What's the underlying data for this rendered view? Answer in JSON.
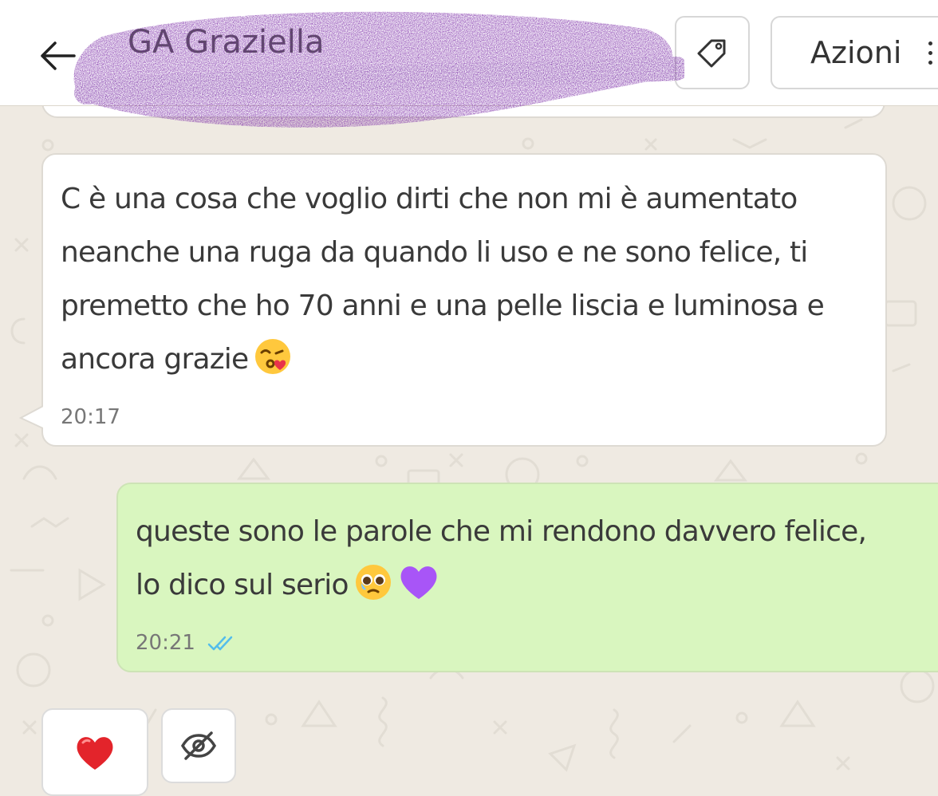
{
  "header": {
    "contact_name": "GA Graziella",
    "back_icon": "arrow-left-icon",
    "tag_icon": "tag-icon",
    "actions_label": "Azioni",
    "more_icon": "kebab-menu-icon"
  },
  "messages": [
    {
      "direction": "incoming",
      "text": "C è una cosa che voglio dirti che non mi è aumentato\nneanche una ruga da quando li uso e ne sono felice, ti\npremetto che ho 70 anni e una pelle liscia e luminosa e\nancora grazie",
      "emoji": [
        "face-blowing-kiss"
      ],
      "time": "20:17"
    },
    {
      "direction": "outgoing",
      "text": "queste sono le parole che mi rendono davvero felice,\nlo dico sul serio",
      "emoji": [
        "pleading-face",
        "purple-heart"
      ],
      "time": "20:21",
      "status": "read",
      "status_icon": "double-check-icon"
    }
  ],
  "reactions": [
    {
      "icon": "red-heart-icon",
      "label": "❤️"
    },
    {
      "icon": "eye-off-icon"
    }
  ],
  "colors": {
    "background": "#efeae2",
    "incoming_bubble": "#ffffff",
    "outgoing_bubble": "#d9f6bf",
    "read_ticks": "#53bdeb",
    "redaction": "#7a2aa6"
  }
}
